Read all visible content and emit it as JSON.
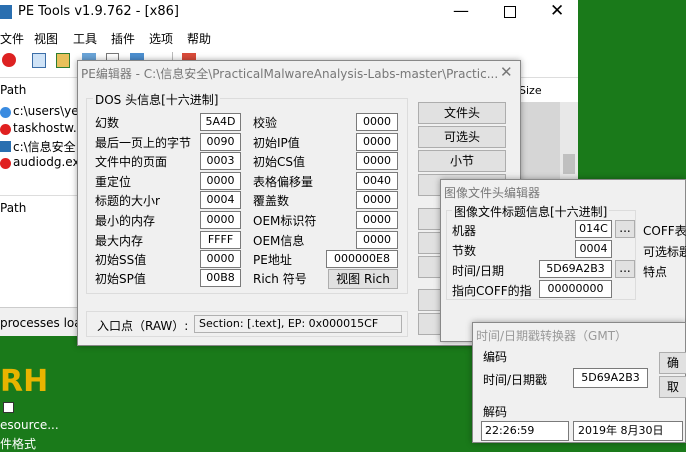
{
  "main_window": {
    "title": "PE Tools v1.9.762 - [x86]",
    "menu": [
      "文件",
      "视图",
      "工具",
      "插件",
      "选项",
      "帮助"
    ],
    "list_header_path": "Path",
    "list_header_size": "Size",
    "process_paths": [
      "c:\\users\\yest",
      "taskhostw.ex",
      "c:\\信息安全",
      "audiodg.exe"
    ],
    "lower_header_path": "Path",
    "status": "processes load"
  },
  "desktop": {
    "icon_text": "RH",
    "icon_label": "esource...",
    "icon_label2": "件格式"
  },
  "pe_editor": {
    "title": "PE编辑器 - C:\\信息安全\\PracticalMalwareAnalysis-Labs-master\\Practic...",
    "group_title": "DOS 头信息[十六进制]",
    "left_fields": [
      {
        "label": "幻数",
        "value": "5A4D"
      },
      {
        "label": "最后一页上的字节",
        "value": "0090"
      },
      {
        "label": "文件中的页面",
        "value": "0003"
      },
      {
        "label": "重定位",
        "value": "0000"
      },
      {
        "label": "标题的大小r",
        "value": "0004"
      },
      {
        "label": "最小的内存",
        "value": "0000"
      },
      {
        "label": "最大内存",
        "value": "FFFF"
      },
      {
        "label": "初始SS值",
        "value": "0000"
      },
      {
        "label": "初始SP值",
        "value": "00B8"
      }
    ],
    "right_fields": [
      {
        "label": "校验",
        "value": "0000"
      },
      {
        "label": "初始IP值",
        "value": "0000"
      },
      {
        "label": "初始CS值",
        "value": "0000"
      },
      {
        "label": "表格偏移量",
        "value": "0040"
      },
      {
        "label": "覆盖数",
        "value": "0000"
      },
      {
        "label": "OEM标识符",
        "value": "0000"
      },
      {
        "label": "OEM信息",
        "value": "0000"
      }
    ],
    "pe_address_label": "PE地址",
    "pe_address_value": "000000E8",
    "rich_label": "Rich 符号",
    "view_rich_button": "视图 Rich",
    "buttons": [
      "文件头",
      "可选头",
      "小节"
    ],
    "entry_label": "入口点（RAW）:",
    "entry_value": "Section: [.text], EP: 0x000015CF"
  },
  "file_header_editor": {
    "title": "图像文件头编辑器",
    "group_title": "图像文件标题信息[十六进制]",
    "fields": [
      {
        "label": "机器",
        "value": "014C"
      },
      {
        "label": "节数",
        "value": "0004"
      },
      {
        "label": "时间/日期",
        "value": "5D69A2B3"
      },
      {
        "label": "指向COFF的指",
        "value": "00000000"
      }
    ],
    "ellipsis": "...",
    "right_labels": [
      "COFF表大",
      "可选标题",
      "特点"
    ]
  },
  "time_converter": {
    "title": "时间/日期戳转换器（GMT）",
    "encode_label": "编码",
    "timestamp_label": "时间/日期戳",
    "timestamp_value": "5D69A2B3",
    "decode_label": "解码",
    "time_value": "22:26:59",
    "date_value": "2019年  8月30日",
    "right_btn1": "确",
    "right_btn2": "取"
  }
}
